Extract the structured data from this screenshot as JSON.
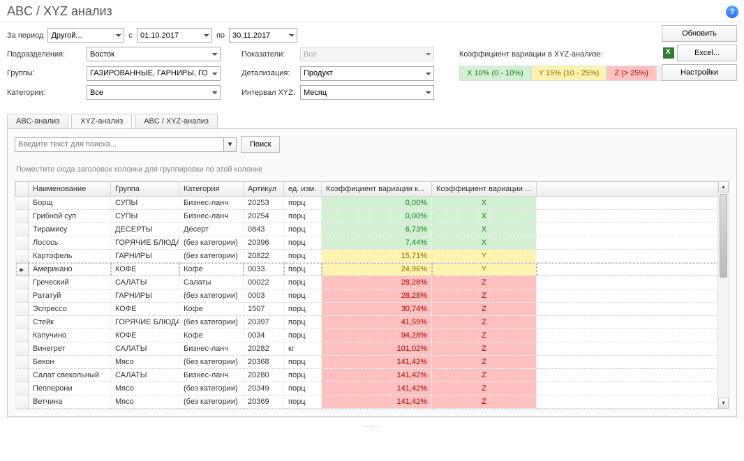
{
  "header": {
    "title": "ABC / XYZ анализ"
  },
  "period": {
    "label": "За период",
    "value": "Другой...",
    "from_label": "с",
    "from": "01.10.2017",
    "to_label": "по",
    "to": "30.11.2017"
  },
  "buttons": {
    "refresh": "Обновить",
    "excel": "Excel...",
    "settings": "Настройки",
    "search": "Поиск"
  },
  "filters": {
    "subdivisions_label": "Подразделения:",
    "subdivisions": "Восток",
    "indicators_label": "Показатели:",
    "indicators": "Все",
    "groups_label": "Группы:",
    "groups": "ГАЗИРОВАННЫЕ, ГАРНИРЫ, ГОР...",
    "detail_label": "Детализация:",
    "detail": "Продукт",
    "categories_label": "Категории:",
    "categories": "Все",
    "interval_label": "Интервал XYZ:",
    "interval": "Месяц"
  },
  "legend": {
    "caption": "Коэффициент вариации в XYZ-анализе:",
    "x": "X 10% (0 - 10%)",
    "y": "Y 15% (10 - 25%)",
    "z": "Z  (> 25%)",
    "more": "..."
  },
  "tabs": {
    "abc": "ABC-анализ",
    "xyz": "XYZ-анализ",
    "abcxyz": "ABC / XYZ-анализ"
  },
  "search_placeholder": "Введите текст для поиска...",
  "group_hint": "Поместите сюда заголовок колонки для группировки по этой колонке",
  "grid": {
    "headers": {
      "name": "Наименование",
      "group": "Группа",
      "category": "Категория",
      "article": "Артикул",
      "unit": "ед. изм.",
      "coef": "Коэффициент вариации к...",
      "cls": "Коэффициент вариации ..."
    },
    "rows": [
      {
        "name": "Борщ",
        "group": "СУПЫ",
        "category": "Бизнес-ланч",
        "article": "20253",
        "unit": "порц",
        "coef": "0,00%",
        "cls": "X",
        "zone": "x"
      },
      {
        "name": "Грибной суп",
        "group": "СУПЫ",
        "category": "Бизнес-ланч",
        "article": "20254",
        "unit": "порц",
        "coef": "0,00%",
        "cls": "X",
        "zone": "x"
      },
      {
        "name": "Тирамису",
        "group": "ДЕСЕРТЫ",
        "category": "Десерт",
        "article": "0843",
        "unit": "порц",
        "coef": "6,73%",
        "cls": "X",
        "zone": "x"
      },
      {
        "name": "Лосось",
        "group": "ГОРЯЧИЕ БЛЮДА",
        "category": "(без категории)",
        "article": "20396",
        "unit": "порц",
        "coef": "7,44%",
        "cls": "X",
        "zone": "x"
      },
      {
        "name": "Картофель",
        "group": "ГАРНИРЫ",
        "category": "(без категории)",
        "article": "20822",
        "unit": "порц",
        "coef": "15,71%",
        "cls": "Y",
        "zone": "y"
      },
      {
        "name": "Американо",
        "group": "КОФЕ",
        "category": "Кофе",
        "article": "0033",
        "unit": "порц",
        "coef": "24,96%",
        "cls": "Y",
        "zone": "y",
        "current": true
      },
      {
        "name": "Греческий",
        "group": "САЛАТЫ",
        "category": "Салаты",
        "article": "00022",
        "unit": "порц",
        "coef": "28,28%",
        "cls": "Z",
        "zone": "z"
      },
      {
        "name": "Рататуй",
        "group": "ГАРНИРЫ",
        "category": "(без категории)",
        "article": "0003",
        "unit": "порц",
        "coef": "28,28%",
        "cls": "Z",
        "zone": "z"
      },
      {
        "name": "Эспрессо",
        "group": "КОФЕ",
        "category": "Кофе",
        "article": "1507",
        "unit": "порц",
        "coef": "30,74%",
        "cls": "Z",
        "zone": "z"
      },
      {
        "name": "Стейк",
        "group": "ГОРЯЧИЕ БЛЮДА",
        "category": "(без категории)",
        "article": "20397",
        "unit": "порц",
        "coef": "41,59%",
        "cls": "Z",
        "zone": "z"
      },
      {
        "name": "Капучино",
        "group": "КОФЕ",
        "category": "Кофе",
        "article": "0034",
        "unit": "порц",
        "coef": "94,28%",
        "cls": "Z",
        "zone": "z"
      },
      {
        "name": "Винегрет",
        "group": "САЛАТЫ",
        "category": "Бизнес-ланч",
        "article": "20282",
        "unit": "кг",
        "coef": "101,02%",
        "cls": "Z",
        "zone": "z"
      },
      {
        "name": "Бекон",
        "group": "Мясо",
        "category": "(без категории)",
        "article": "20368",
        "unit": "порц",
        "coef": "141,42%",
        "cls": "Z",
        "zone": "z"
      },
      {
        "name": "Салат свекольный",
        "group": "САЛАТЫ",
        "category": "Бизнес-ланч",
        "article": "20280",
        "unit": "порц",
        "coef": "141,42%",
        "cls": "Z",
        "zone": "z"
      },
      {
        "name": "Пепперони",
        "group": "Мясо",
        "category": "(без категории)",
        "article": "20349",
        "unit": "порц",
        "coef": "141,42%",
        "cls": "Z",
        "zone": "z"
      },
      {
        "name": "Ветчина",
        "group": "Мясо",
        "category": "(без категории)",
        "article": "20369",
        "unit": "порц",
        "coef": "141,42%",
        "cls": "Z",
        "zone": "z"
      }
    ]
  },
  "splitter_dots": "....."
}
